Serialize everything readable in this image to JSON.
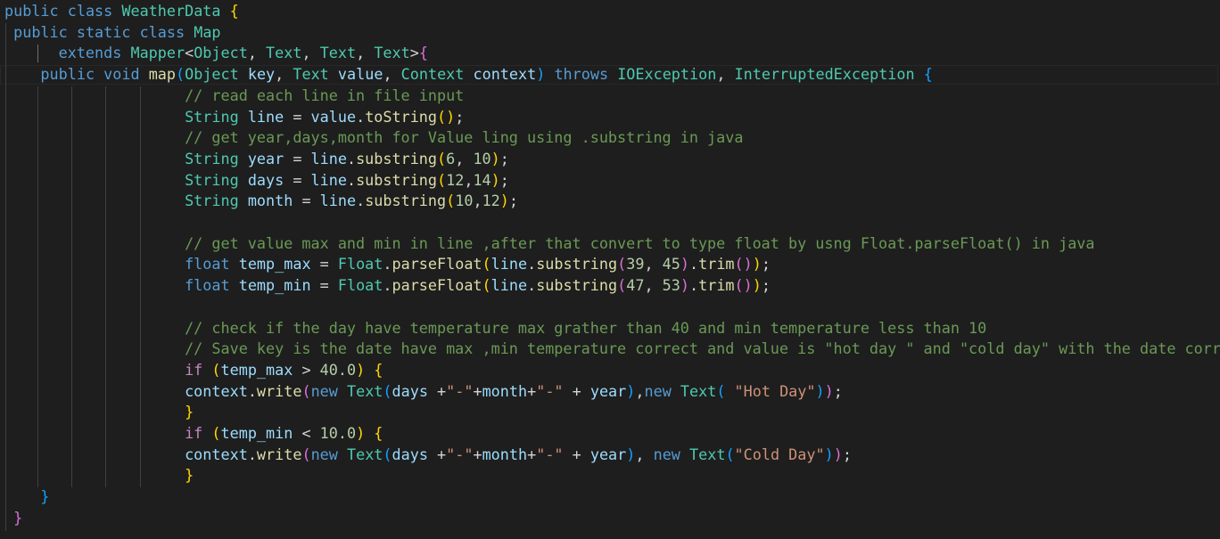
{
  "editor": {
    "language": "java",
    "theme": "dark",
    "colors": {
      "background": "#1e1e1e",
      "keyword": "#569cd6",
      "control_keyword": "#c586c0",
      "type": "#4ec9b0",
      "function": "#dcdcaa",
      "variable": "#9cdcfe",
      "string": "#ce9178",
      "number": "#b5cea8",
      "comment": "#6a9955",
      "bracket_level_1": "#ffd700",
      "bracket_level_2": "#da70d6",
      "bracket_level_3": "#179fff"
    },
    "lines": [
      [
        [
          "kw",
          "public"
        ],
        [
          "",
          "' '"
        ],
        [
          "kw",
          "class"
        ],
        [
          "",
          ""
        ],
        [
          "type",
          "WeatherData"
        ],
        [
          "",
          ""
        ],
        [
          "p1",
          "{"
        ]
      ],
      [
        [
          "",
          ""
        ]
      ]
    ]
  }
}
